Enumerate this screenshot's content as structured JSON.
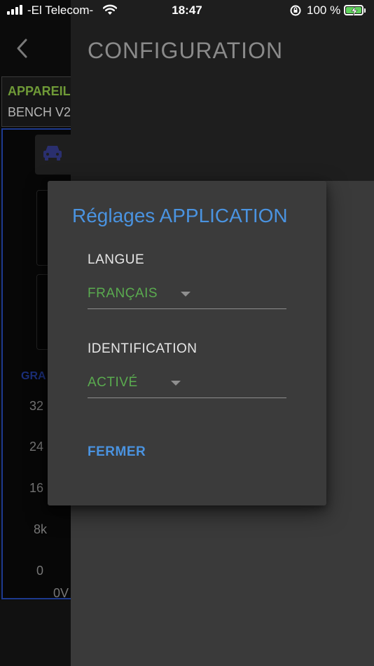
{
  "status_bar": {
    "carrier": "-El Telecom-",
    "time": "18:47",
    "battery": "100 %",
    "icons": [
      "signal-icon",
      "wifi-icon",
      "rotation-lock-icon",
      "battery-charging-icon"
    ]
  },
  "header": {
    "title": "CONFIGURATION",
    "back_icon": "chevron-left-icon"
  },
  "background": {
    "device_label": "APPAREIL",
    "device_name": "BENCH V2",
    "graph_label": "GRA",
    "y_ticks": [
      "32",
      "24",
      "16",
      "8k",
      "0"
    ],
    "x_tick": "0V",
    "car_icon": "car-icon",
    "colors": {
      "device_label": "#6f9a37",
      "panel_border": "#1d3a8f"
    }
  },
  "dialog": {
    "title": "Réglages APPLICATION",
    "fields": [
      {
        "label": "LANGUE",
        "value": "FRANÇAIS"
      },
      {
        "label": "IDENTIFICATION",
        "value": "ACTIVÉ"
      }
    ],
    "close_label": "FERMER",
    "colors": {
      "title": "#4a93e0",
      "value": "#5aab4f",
      "background": "#3b3b3b"
    }
  }
}
